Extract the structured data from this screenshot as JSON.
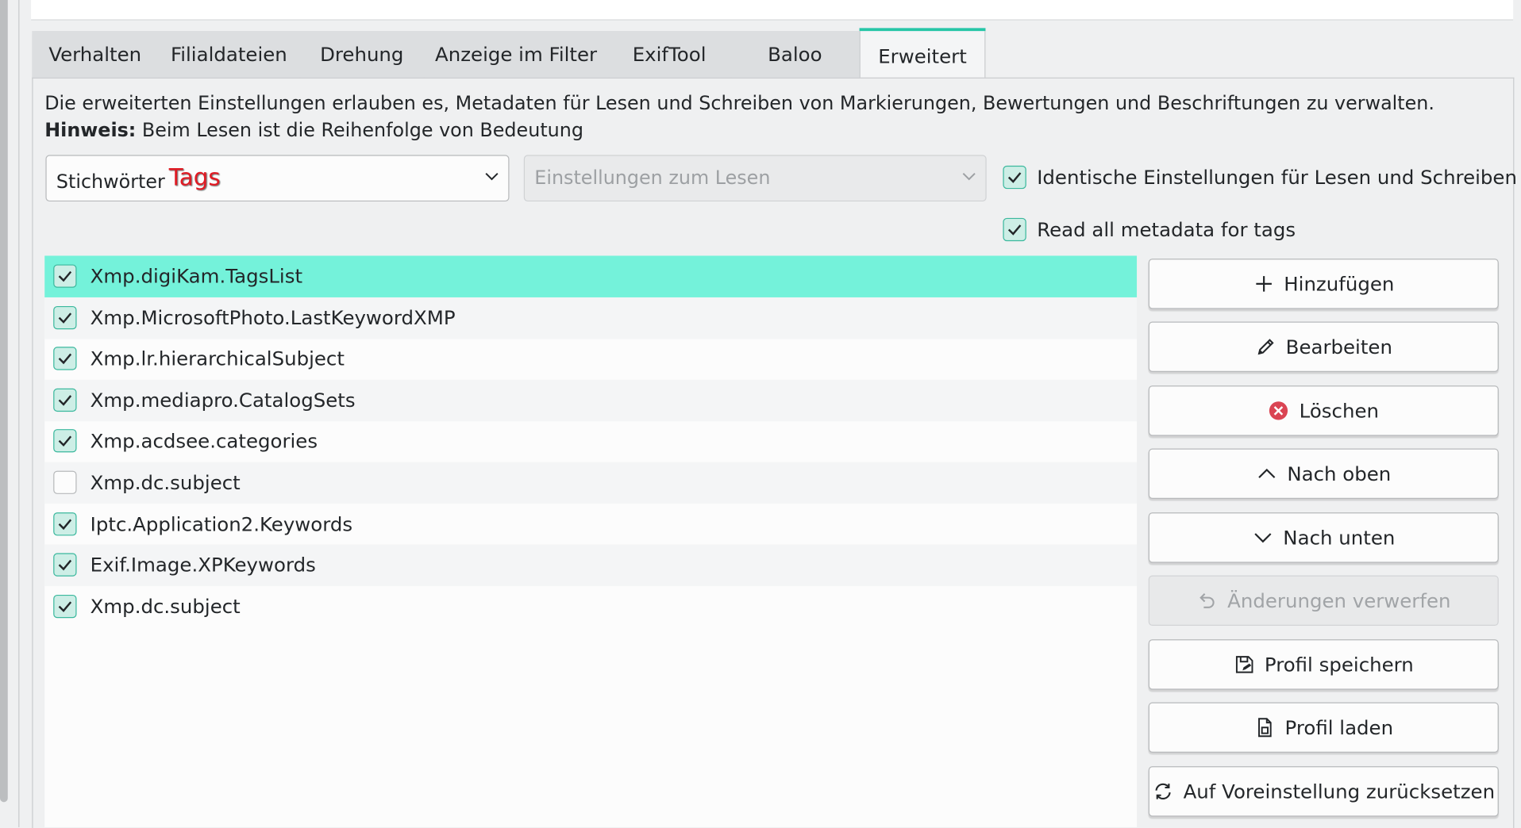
{
  "tabs": [
    {
      "label": "Verhalten"
    },
    {
      "label": "Filialdateien"
    },
    {
      "label": "Drehung"
    },
    {
      "label": "Anzeige im Filter"
    },
    {
      "label": "ExifTool"
    },
    {
      "label": "Baloo"
    },
    {
      "label": "Erweitert",
      "active": true
    }
  ],
  "description": {
    "line1": "Die erweiterten Einstellungen erlauben es, Metadaten für Lesen und Schreiben von Markierungen, Bewertungen und Beschriftungen zu verwalten.",
    "hint_bold": "Hinweis:",
    "hint_text": " Beim Lesen ist die Reihenfolge von Bedeutung"
  },
  "category_combo": {
    "label": "Stichwörter",
    "overlay": "Tags"
  },
  "mode_combo": {
    "label": "Einstellungen zum Lesen"
  },
  "options": {
    "identical": {
      "label": "Identische Einstellungen für Lesen und Schreiben",
      "checked": true
    },
    "read_all": {
      "label": "Read all metadata for tags",
      "checked": true
    }
  },
  "namespaces": [
    {
      "label": "Xmp.digiKam.TagsList",
      "checked": true,
      "selected": true
    },
    {
      "label": "Xmp.MicrosoftPhoto.LastKeywordXMP",
      "checked": true
    },
    {
      "label": "Xmp.lr.hierarchicalSubject",
      "checked": true
    },
    {
      "label": "Xmp.mediapro.CatalogSets",
      "checked": true
    },
    {
      "label": "Xmp.acdsee.categories",
      "checked": true
    },
    {
      "label": "Xmp.dc.subject",
      "checked": false
    },
    {
      "label": "Iptc.Application2.Keywords",
      "checked": true
    },
    {
      "label": "Exif.Image.XPKeywords",
      "checked": true
    },
    {
      "label": "Xmp.dc.subject",
      "checked": true
    }
  ],
  "buttons": {
    "add": "Hinzufügen",
    "edit": "Bearbeiten",
    "delete": "Löschen",
    "up": "Nach oben",
    "down": "Nach unten",
    "revert": "Änderungen verwerfen",
    "save_profile": "Profil speichern",
    "load_profile": "Profil laden",
    "reset": "Auf Voreinstellung zurücksetzen"
  },
  "colors": {
    "accent": "#26c6a6",
    "selection": "#74f2da",
    "delete_icon": "#da4453"
  }
}
